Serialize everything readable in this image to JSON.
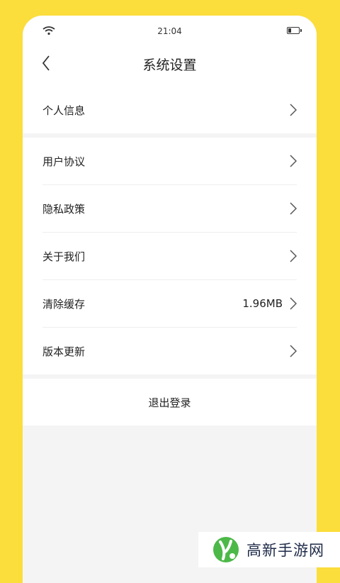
{
  "status_bar": {
    "time": "21:04",
    "icons": [
      "wifi-icon",
      "battery-icon"
    ]
  },
  "header": {
    "title": "系统设置",
    "back_icon": "chevron-left-icon"
  },
  "groups": [
    {
      "items": [
        {
          "label": "个人信息"
        }
      ]
    },
    {
      "items": [
        {
          "label": "用户协议"
        },
        {
          "label": "隐私政策"
        },
        {
          "label": "关于我们"
        },
        {
          "label": "清除缓存",
          "value": "1.96MB"
        },
        {
          "label": "版本更新"
        }
      ]
    }
  ],
  "logout": {
    "label": "退出登录"
  },
  "watermark": {
    "text": "高新手游网"
  },
  "colors": {
    "background": "#FBDD3C",
    "page": "#f4f4f4",
    "card": "#ffffff",
    "text": "#222222",
    "watermark_text": "#1e2a48",
    "watermark_green": "#4CB848"
  }
}
